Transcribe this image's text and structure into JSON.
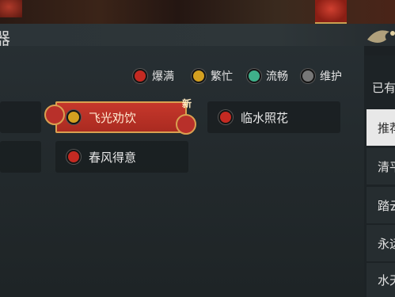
{
  "window": {
    "title_partial": "器"
  },
  "legend": [
    {
      "label": "爆满",
      "color": "#c42a22"
    },
    {
      "label": "繁忙",
      "color": "#d4a020"
    },
    {
      "label": "流畅",
      "color": "#3fb08a"
    },
    {
      "label": "维护",
      "color": "#777777"
    }
  ],
  "servers": {
    "selected": {
      "name": "飞光劝饮",
      "status_color": "#d4a020",
      "badge": "新"
    },
    "items": [
      {
        "name": "临水照花",
        "status_color": "#c42a22"
      },
      {
        "name": "春风得意",
        "status_color": "#c42a22"
      }
    ]
  },
  "sidebar": {
    "header": "已有",
    "items": [
      {
        "label": "推荐",
        "active": true
      },
      {
        "label": "清平"
      },
      {
        "label": "踏云"
      },
      {
        "label": "永远"
      },
      {
        "label": "水天"
      }
    ]
  }
}
